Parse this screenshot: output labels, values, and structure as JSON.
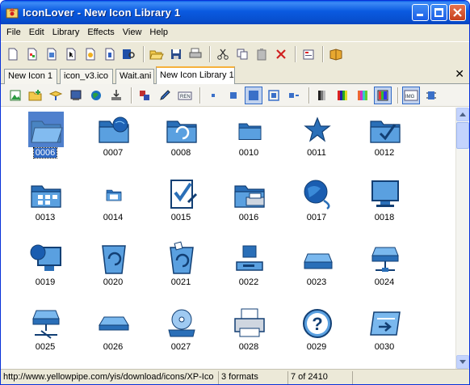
{
  "window": {
    "title": "IconLover - New Icon Library 1"
  },
  "menu": [
    "File",
    "Edit",
    "Library",
    "Effects",
    "View",
    "Help"
  ],
  "tabs": [
    "New Icon 1",
    "icon_v3.ico",
    "Wait.ani",
    "New Icon Library 1"
  ],
  "icons": [
    {
      "label": "0006",
      "icon": "folder-open-icon",
      "selected": true
    },
    {
      "label": "0007",
      "icon": "folder-globe-icon"
    },
    {
      "label": "0008",
      "icon": "folder-refresh-icon"
    },
    {
      "label": "0010",
      "icon": "folder-small-icon"
    },
    {
      "label": "0011",
      "icon": "star-icon"
    },
    {
      "label": "0012",
      "icon": "folder-check-icon"
    },
    {
      "label": "0013",
      "icon": "folder-apps-icon"
    },
    {
      "label": "0014",
      "icon": "folder-apps-small-icon"
    },
    {
      "label": "0015",
      "icon": "checklist-icon"
    },
    {
      "label": "0016",
      "icon": "printer-folder-icon"
    },
    {
      "label": "0017",
      "icon": "globe-cable-icon"
    },
    {
      "label": "0018",
      "icon": "monitor-icon"
    },
    {
      "label": "0019",
      "icon": "monitor-globe-icon"
    },
    {
      "label": "0020",
      "icon": "recycle-bin-icon"
    },
    {
      "label": "0021",
      "icon": "recycle-bin-full-icon"
    },
    {
      "label": "0022",
      "icon": "floppy-drive-icon"
    },
    {
      "label": "0023",
      "icon": "hard-drive-icon"
    },
    {
      "label": "0024",
      "icon": "network-drive-icon"
    },
    {
      "label": "0025",
      "icon": "network-drive-alt-icon"
    },
    {
      "label": "0026",
      "icon": "drive-flat-icon"
    },
    {
      "label": "0027",
      "icon": "cd-drive-icon"
    },
    {
      "label": "0028",
      "icon": "printer-icon"
    },
    {
      "label": "0029",
      "icon": "help-icon"
    },
    {
      "label": "0030",
      "icon": "window-arrow-icon"
    }
  ],
  "status": {
    "url": "http://www.yellowpipe.com/yis/download/icons/XP-Ico",
    "formats": "3 formats",
    "position": "7 of 2410"
  },
  "colors": {
    "accent": "#0a5ae0",
    "iconBlue": "#2a6fb8",
    "iconDark": "#123f74"
  }
}
